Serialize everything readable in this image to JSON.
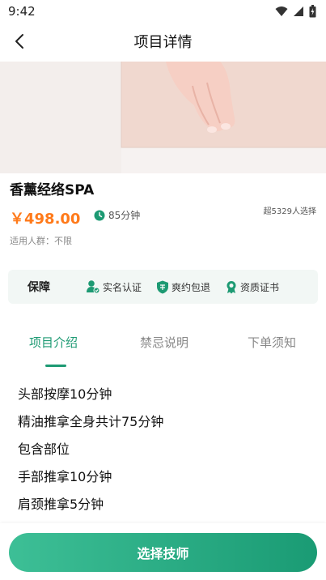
{
  "status_bar": {
    "time": "9:42"
  },
  "header": {
    "title": "项目详情"
  },
  "service": {
    "name": "香薰经络SPA",
    "price": "￥498.00",
    "duration": "85分钟",
    "sold": "超5329人选择",
    "audience": "适用人群：不限"
  },
  "guarantee": {
    "title": "保障",
    "items": [
      {
        "label": "实名认证",
        "icon": "verified-user-icon"
      },
      {
        "label": "爽约包退",
        "icon": "refund-shield-icon"
      },
      {
        "label": "资质证书",
        "icon": "certificate-icon"
      }
    ]
  },
  "tabs": [
    {
      "label": "项目介绍",
      "active": true
    },
    {
      "label": "禁忌说明",
      "active": false
    },
    {
      "label": "下单须知",
      "active": false
    }
  ],
  "intro_lines": [
    "头部按摩10分钟",
    "精油推拿全身共计75分钟",
    "包含部位",
    "手部推拿10分钟",
    "肩颈推拿5分钟"
  ],
  "actions": {
    "primary_label": "选择技师"
  },
  "colors": {
    "accent": "#1d9a73",
    "price": "#ff7a1a"
  }
}
